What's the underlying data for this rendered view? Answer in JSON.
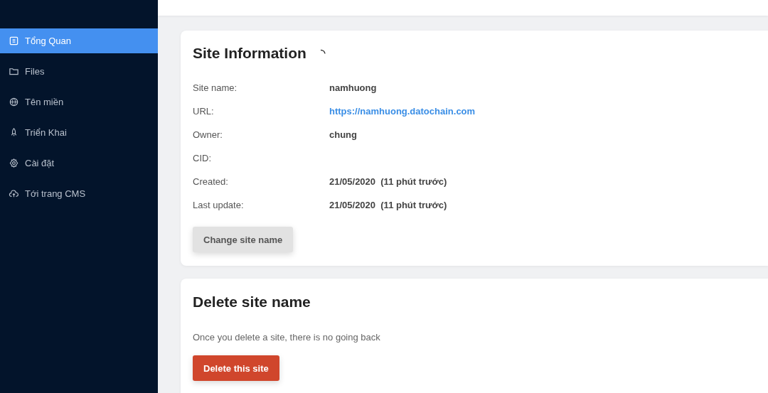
{
  "sidebar": {
    "items": [
      {
        "kind": "page",
        "label": "Tổng Quan",
        "selected": true
      },
      {
        "kind": "folder",
        "label": "Files",
        "selected": false
      },
      {
        "kind": "globe",
        "label": "Tên miền",
        "selected": false
      },
      {
        "kind": "rocket",
        "label": "Triển Khai",
        "selected": false
      },
      {
        "kind": "gear",
        "label": "Cài đặt",
        "selected": false
      },
      {
        "kind": "cloud",
        "label": "Tới trang CMS",
        "selected": false
      }
    ]
  },
  "site_information": {
    "title": "Site Information",
    "loading": true,
    "rows": [
      {
        "label": "Site name:",
        "value": "namhuong",
        "kind": "text"
      },
      {
        "label": "URL:",
        "value": "https://namhuong.datochain.com",
        "kind": "link"
      },
      {
        "label": "Owner:",
        "value": "chung",
        "kind": "text"
      },
      {
        "label": "CID:"
      },
      {
        "label": "Created:",
        "value": "21/05/2020  (11 phút trước)",
        "kind": "text"
      },
      {
        "label": "Last update:",
        "value": "21/05/2020  (11 phút trước)",
        "kind": "text"
      }
    ],
    "button": "Change site name"
  },
  "delete_site": {
    "title": "Delete site name",
    "description": "Once you delete a site, there is no going back",
    "button": "Delete this site"
  }
}
